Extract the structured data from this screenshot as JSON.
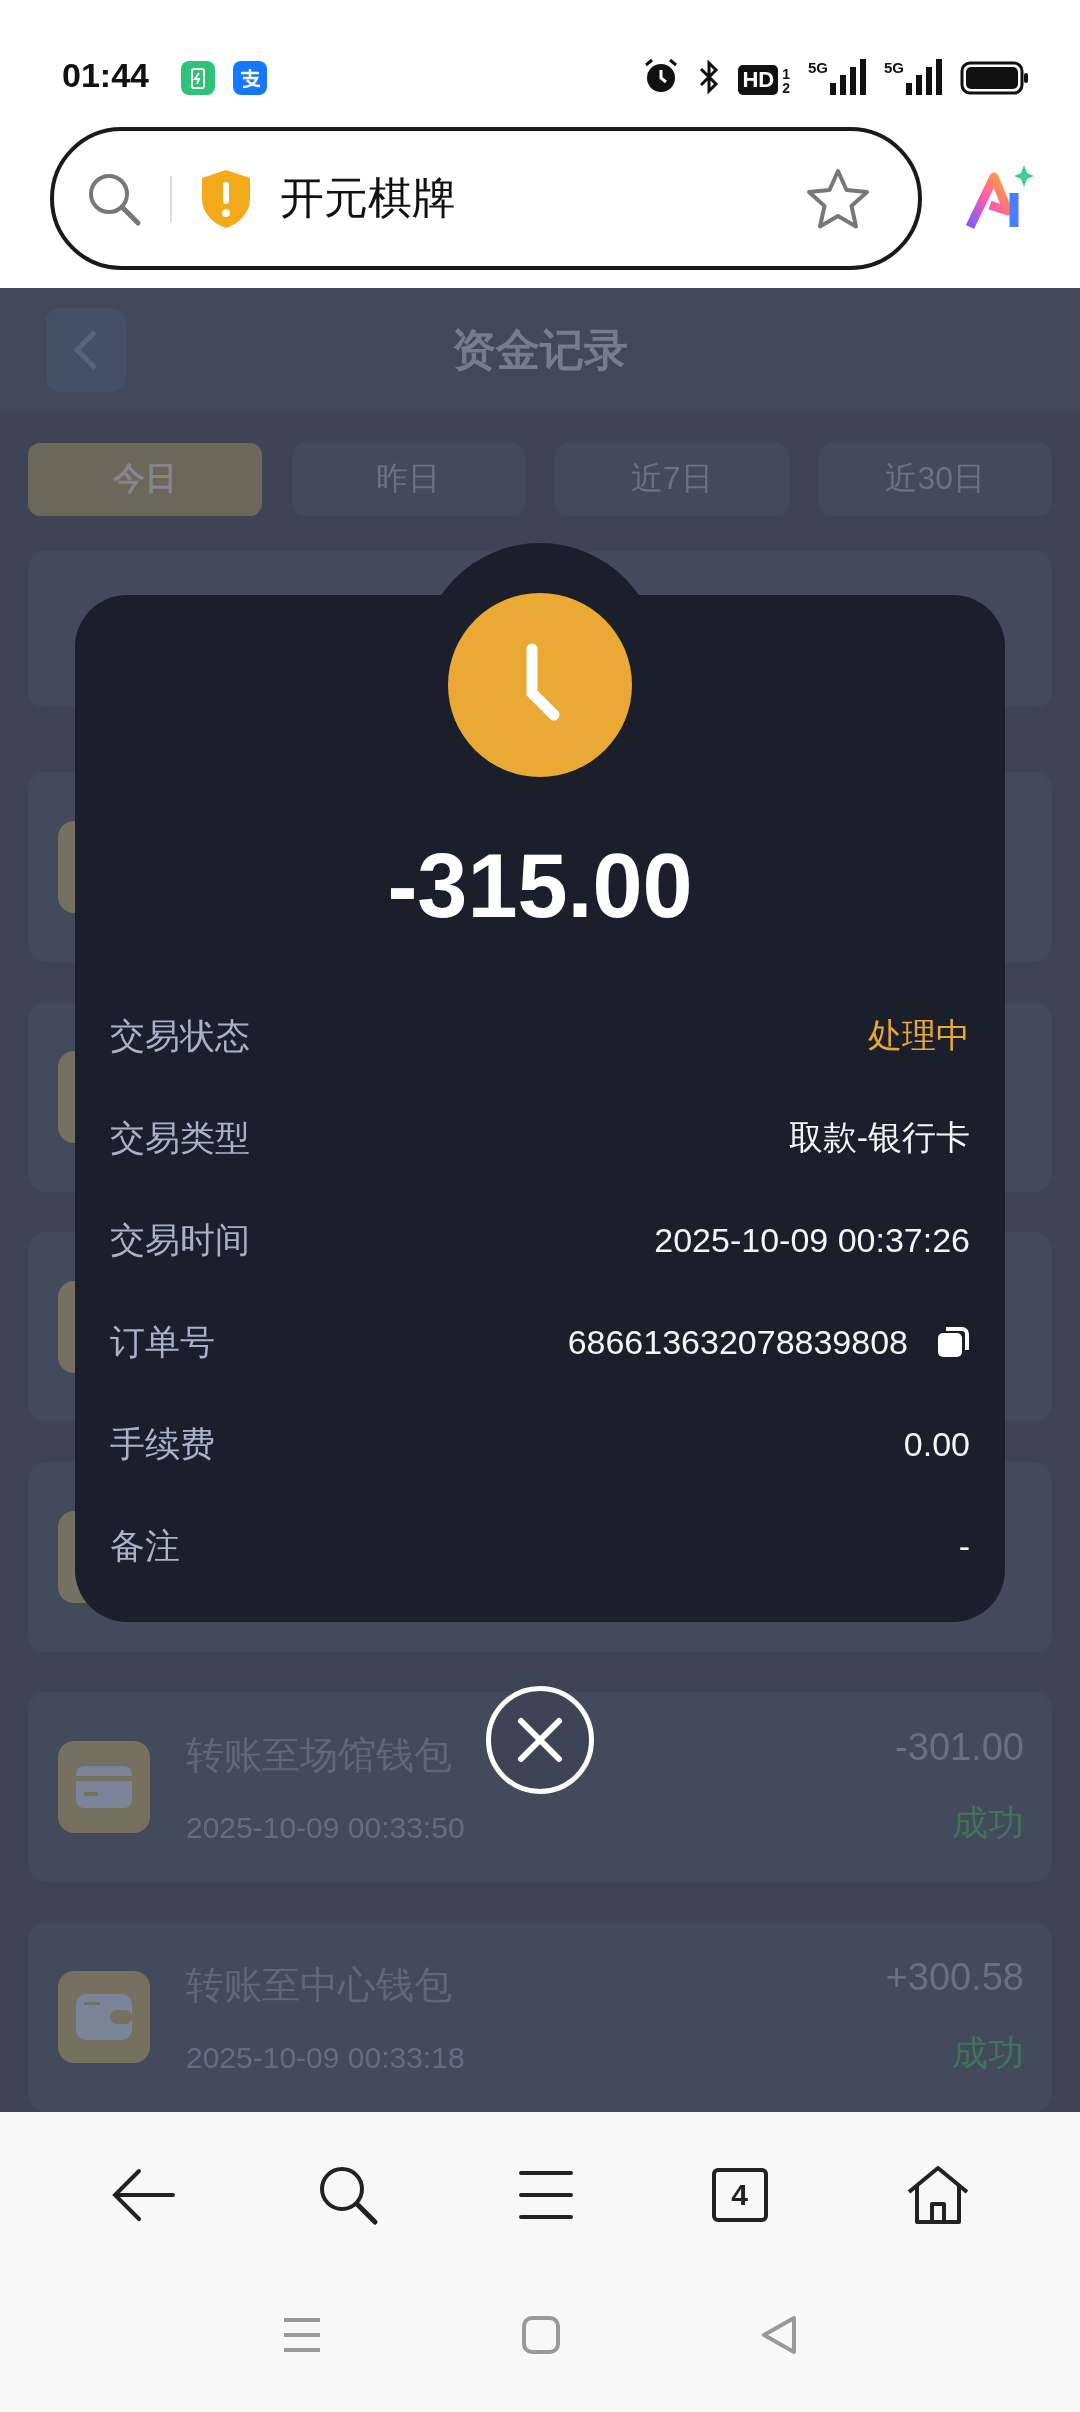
{
  "status_bar": {
    "time": "01:44",
    "hd_badge": "HD",
    "sim_slots": [
      "1",
      "2"
    ],
    "networks": [
      "5G",
      "5G"
    ]
  },
  "address_bar": {
    "text": "开元棋牌"
  },
  "page": {
    "title": "资金记录",
    "tabs": [
      {
        "label": "今日",
        "selected": true
      },
      {
        "label": "昨日",
        "selected": false
      },
      {
        "label": "近7日",
        "selected": false
      },
      {
        "label": "近30日",
        "selected": false
      }
    ],
    "records": [
      {
        "kind": "out",
        "title": "转账至场馆钱包",
        "time": "2025-10-09 00:33:50",
        "amount": "-301.00",
        "status": "成功"
      },
      {
        "kind": "in",
        "title": "转账至中心钱包",
        "time": "2025-10-09 00:33:18",
        "amount": "+300.58",
        "status": "成功"
      }
    ]
  },
  "detail": {
    "amount": "-315.00",
    "fields": [
      {
        "label": "交易状态",
        "value": "处理中",
        "kind": "status"
      },
      {
        "label": "交易类型",
        "value": "取款-银行卡",
        "kind": "text"
      },
      {
        "label": "交易时间",
        "value": "2025-10-09 00:37:26",
        "kind": "text"
      },
      {
        "label": "订单号",
        "value": "686613632078839808",
        "kind": "copy"
      },
      {
        "label": "手续费",
        "value": "0.00",
        "kind": "text"
      },
      {
        "label": "备注",
        "value": "-",
        "kind": "text"
      }
    ]
  },
  "browser_nav": {
    "tab_count": "4"
  }
}
